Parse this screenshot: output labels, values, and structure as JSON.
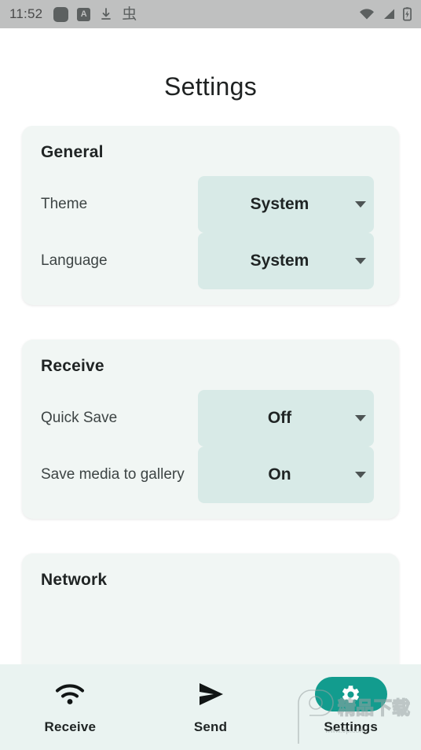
{
  "status_bar": {
    "time": "11:52",
    "left_icons": [
      {
        "name": "app-square-icon",
        "glyph": ""
      },
      {
        "name": "a-badge-icon",
        "glyph": "A"
      },
      {
        "name": "download-icon",
        "glyph": "⤓"
      },
      {
        "name": "cjk-app-icon",
        "glyph": "虫"
      }
    ],
    "right_icons": [
      {
        "name": "wifi-icon"
      },
      {
        "name": "cellular-signal-icon"
      },
      {
        "name": "battery-charging-icon"
      }
    ]
  },
  "header": {
    "title": "Settings"
  },
  "cards": [
    {
      "title": "General",
      "rows": [
        {
          "label": "Theme",
          "value": "System"
        },
        {
          "label": "Language",
          "value": "System"
        }
      ]
    },
    {
      "title": "Receive",
      "rows": [
        {
          "label": "Quick Save",
          "value": "Off"
        },
        {
          "label": "Save media to gallery",
          "value": "On"
        }
      ]
    },
    {
      "title": "Network",
      "rows": []
    }
  ],
  "bottom_nav": {
    "items": [
      {
        "label": "Receive",
        "icon": "wifi-icon",
        "active": false
      },
      {
        "label": "Send",
        "icon": "send-icon",
        "active": false
      },
      {
        "label": "Settings",
        "icon": "gear-icon",
        "active": true
      }
    ]
  },
  "watermark": {
    "text_cn": "精品下载",
    "text_url": "www.9p.com"
  },
  "colors": {
    "accent_teal": "#129c8e",
    "card_bg": "#f1f6f4",
    "chip_bg": "#d8eae7",
    "nav_bg": "#eaf3f1",
    "status_bg": "#bfc0c0"
  }
}
